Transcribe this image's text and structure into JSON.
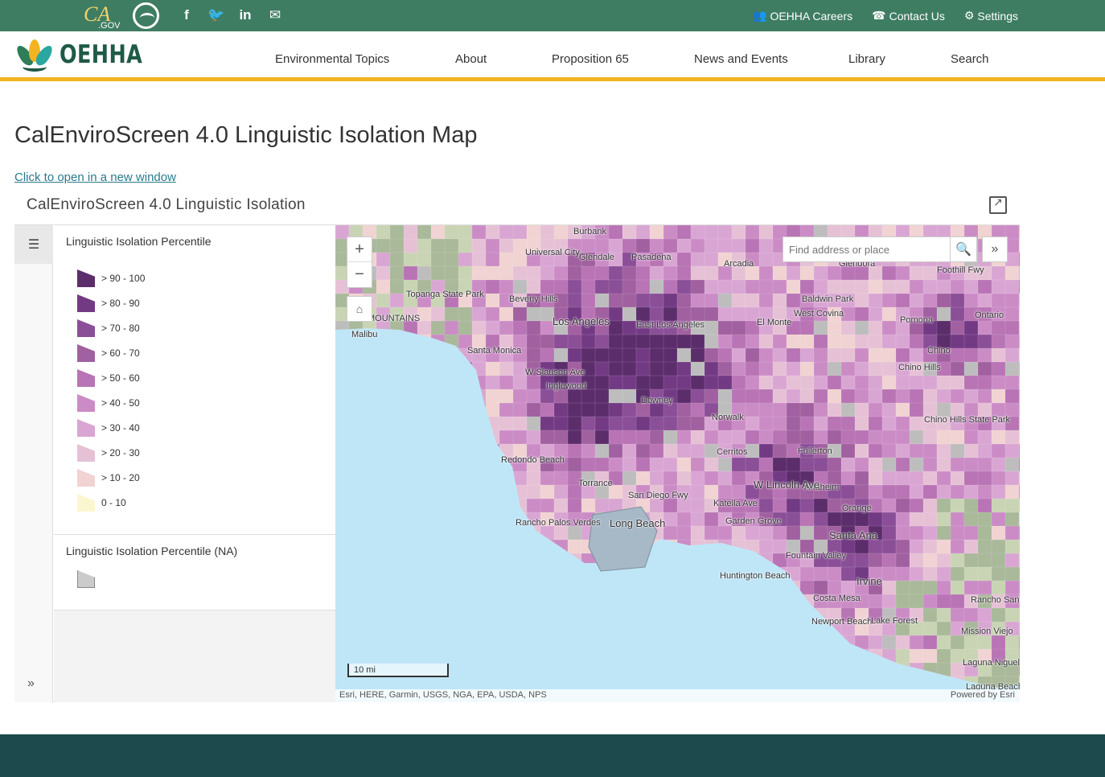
{
  "topbar": {
    "ca_logo": "CA",
    "ca_logo_suffix": ".GOV",
    "social": [
      "facebook-icon",
      "twitter-icon",
      "linkedin-icon",
      "email-icon"
    ],
    "links": [
      {
        "label": "OEHHA Careers",
        "icon": "people-icon"
      },
      {
        "label": "Contact Us",
        "icon": "contact-icon"
      },
      {
        "label": "Settings",
        "icon": "gear-icon"
      }
    ],
    "bg_color": "#3f7d63"
  },
  "header": {
    "brand": "OEHHA",
    "nav": [
      "Environmental Topics",
      "About",
      "Proposition 65",
      "News and Events",
      "Library",
      "Search"
    ],
    "accent_color": "#f2b41f"
  },
  "page": {
    "title": "CalEnviroScreen 4.0 Linguistic Isolation Map",
    "open_link": "Click to open in a new window"
  },
  "app": {
    "title": "CalEnviroScreen 4.0 Linguistic Isolation",
    "legend": {
      "heading": "Linguistic Isolation Percentile",
      "classes": [
        {
          "label": "> 90 - 100",
          "color": "#5c2d6b"
        },
        {
          "label": "> 80 - 90",
          "color": "#733a84"
        },
        {
          "label": "> 70 - 80",
          "color": "#8a4f97"
        },
        {
          "label": "> 60 - 70",
          "color": "#a1609f"
        },
        {
          "label": "> 50 - 60",
          "color": "#b874b4"
        },
        {
          "label": "> 40 - 50",
          "color": "#cb8cc6"
        },
        {
          "label": "> 30 - 40",
          "color": "#d9a6d3"
        },
        {
          "label": "> 20 - 30",
          "color": "#e6c1d6"
        },
        {
          "label": "> 10 - 20",
          "color": "#f0d3d2"
        },
        {
          "label": "0 - 10",
          "color": "#fbf6cf"
        }
      ],
      "na_heading": "Linguistic Isolation Percentile (NA)",
      "na_color": "#cbcbcb"
    },
    "map": {
      "search_placeholder": "Find address or place",
      "scale": "10 mi",
      "attribution": "Esri, HERE, Garmin, USGS, NGA, EPA, USDA, NPS",
      "powered_by": "Powered by Esri",
      "water_color": "#bfe6f7",
      "labels": [
        "Burbank",
        "Universal City",
        "Glendale",
        "Pasadena",
        "Arcadia",
        "Glendora",
        "Foothill Fwy",
        "Beverly Hills",
        "Los Angeles",
        "East Los Angeles",
        "El Monte",
        "Baldwin Park",
        "West Covina",
        "Pomona",
        "Ontario",
        "Malibu",
        "Santa Monica",
        "Topanga State Park",
        "Chino",
        "Chino Hills",
        "Chino Hills State Park",
        "W Slauson Ave",
        "Inglewood",
        "Downey",
        "Norwalk",
        "Cerritos",
        "Fullerton",
        "Redondo Beach",
        "Torrance",
        "San Diego Fwy",
        "Anaheim",
        "W Lincoln Ave",
        "Katella Ave",
        "Orange",
        "Rancho Palos Verdes",
        "Long Beach",
        "Garden Grove",
        "Santa Ana",
        "Fountain Valley",
        "Huntington Beach",
        "Irvine",
        "Costa Mesa",
        "Newport Beach",
        "Lake Forest",
        "Rancho Santa Margarita",
        "Mission Viejo",
        "Laguna Niguel",
        "Laguna Beach",
        "MOUNTAINS"
      ]
    }
  },
  "footer": {
    "color": "#1d4a4c"
  }
}
